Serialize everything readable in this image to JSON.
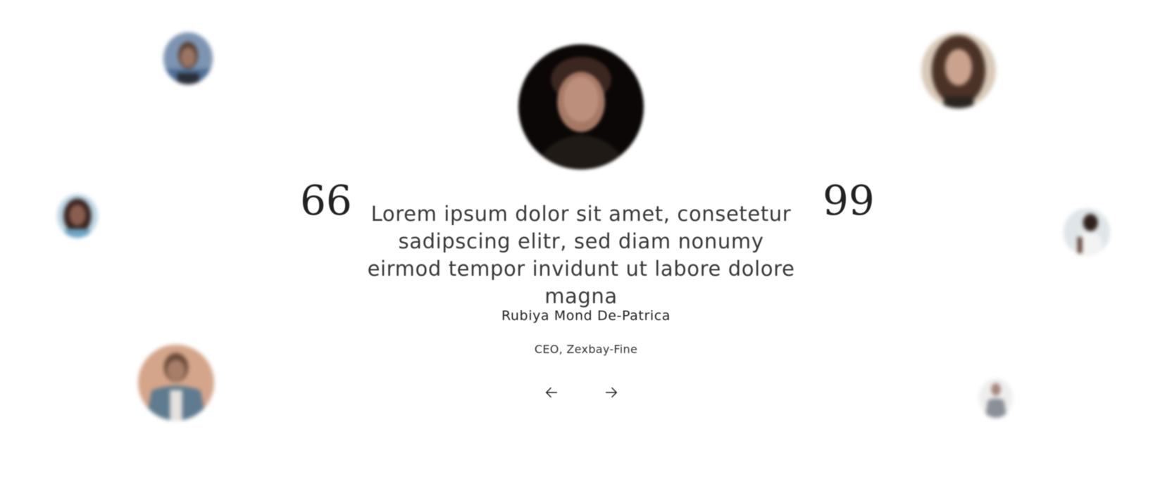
{
  "testimonial": {
    "quote_open": "66",
    "quote_close": "99",
    "text": "Lorem ipsum dolor sit amet, consetetur sadipscing elitr, sed diam nonumy eirmod tempor invidunt ut labore dolore magna",
    "author_name": "Rubiya Mond De-Patrica",
    "author_role": "CEO, Zexbay-Fine"
  },
  "navigation": {
    "prev_icon": "arrow-left-icon",
    "next_icon": "arrow-right-icon"
  },
  "colors": {
    "background": "#ffffff",
    "text": "#3a3a3a",
    "heading": "#222222"
  }
}
